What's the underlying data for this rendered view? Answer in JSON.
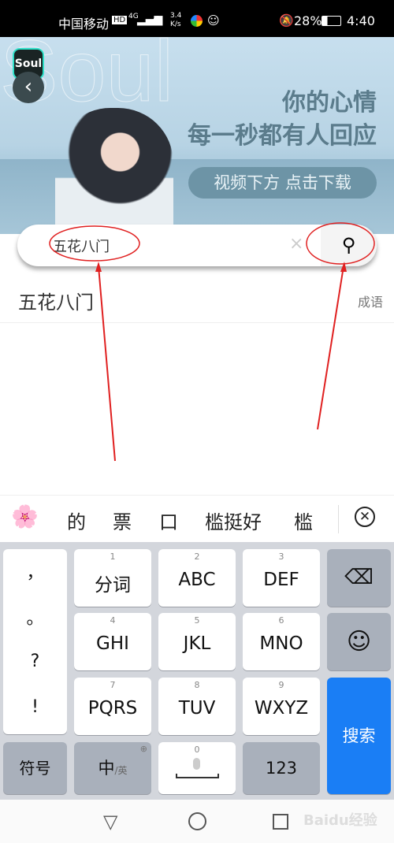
{
  "status_bar": {
    "carrier": "中国移动",
    "hd": "HD",
    "network": "4G",
    "speed": "3.4 K/s",
    "battery": "28%",
    "time": "4:40"
  },
  "banner": {
    "logo": "Soul",
    "headline1": "你的心情",
    "headline2": "每一秒都有人回应",
    "download_label": "视频下方 点击下载"
  },
  "search": {
    "value": "五花八门",
    "clear": "×"
  },
  "results": [
    {
      "title": "五花八门",
      "category": "成语"
    }
  ],
  "candidates": [
    "的",
    "票",
    "口",
    "槛挺好",
    "槛"
  ],
  "keyboard": {
    "punct": [
      "，",
      "。",
      "?",
      "!"
    ],
    "keys": [
      {
        "num": "1",
        "label": "分词"
      },
      {
        "num": "2",
        "label": "ABC"
      },
      {
        "num": "3",
        "label": "DEF"
      },
      {
        "num": "4",
        "label": "GHI"
      },
      {
        "num": "5",
        "label": "JKL"
      },
      {
        "num": "6",
        "label": "MNO"
      },
      {
        "num": "7",
        "label": "PQRS"
      },
      {
        "num": "8",
        "label": "TUV"
      },
      {
        "num": "9",
        "label": "WXYZ"
      }
    ],
    "symbols": "符号",
    "lang_main": "中",
    "lang_sub": "/英",
    "space_num": "0",
    "num_mode": "123",
    "search": "搜索"
  },
  "watermark": "Baidu经验",
  "colors": {
    "accent": "#1a7ef5",
    "annotation": "#e02020"
  }
}
